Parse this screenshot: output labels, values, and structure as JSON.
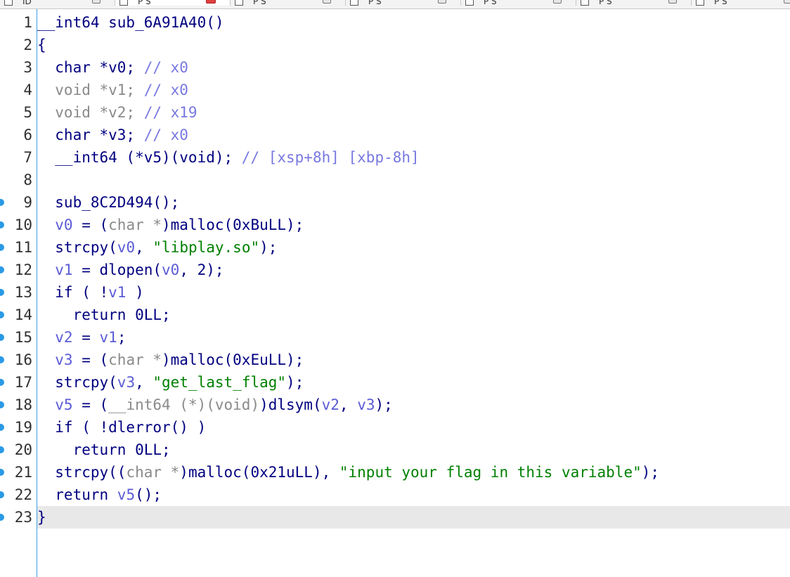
{
  "tabs": [
    {
      "label": "ID",
      "active": false
    },
    {
      "label": "P S",
      "active": true
    },
    {
      "label": "P S",
      "active": false
    },
    {
      "label": "P S",
      "active": false
    },
    {
      "label": "P S",
      "active": false
    },
    {
      "label": "P S",
      "active": false
    },
    {
      "label": "P S",
      "active": false
    }
  ],
  "colors": {
    "keyword": "#000080",
    "variable": "#5b5bd6",
    "string": "#008000",
    "comment": "#7878e0",
    "gutter_border": "#3aa0e6",
    "breakpoint": "#2a9ae6",
    "current_line": "#e8e8e8"
  },
  "editor": {
    "current_line": 23,
    "lines": [
      {
        "no": "1",
        "dot": false,
        "tokens": [
          [
            "id",
            "__int64 sub_6A91A40()"
          ]
        ]
      },
      {
        "no": "2",
        "dot": false,
        "tokens": [
          [
            "id",
            "{"
          ]
        ]
      },
      {
        "no": "3",
        "dot": false,
        "tokens": [
          [
            "id",
            "  char *v0; "
          ],
          [
            "cmt",
            "// x0"
          ]
        ]
      },
      {
        "no": "4",
        "dot": false,
        "tokens": [
          [
            "type",
            "  void *v1; "
          ],
          [
            "cmt",
            "// x0"
          ]
        ]
      },
      {
        "no": "5",
        "dot": false,
        "tokens": [
          [
            "type",
            "  void *v2; "
          ],
          [
            "cmt",
            "// x19"
          ]
        ]
      },
      {
        "no": "6",
        "dot": false,
        "tokens": [
          [
            "id",
            "  char *v3; "
          ],
          [
            "cmt",
            "// x0"
          ]
        ]
      },
      {
        "no": "7",
        "dot": false,
        "tokens": [
          [
            "id",
            "  __int64 (*v5)(void); "
          ],
          [
            "cmt",
            "// [xsp+8h] [xbp-8h]"
          ]
        ]
      },
      {
        "no": "8",
        "dot": false,
        "tokens": [
          [
            "id",
            ""
          ]
        ]
      },
      {
        "no": "9",
        "dot": true,
        "tokens": [
          [
            "id",
            "  sub_8C2D494();"
          ]
        ]
      },
      {
        "no": "10",
        "dot": true,
        "tokens": [
          [
            "var",
            "  v0"
          ],
          [
            "id",
            " = ("
          ],
          [
            "type",
            "char *"
          ],
          [
            "id",
            ")malloc(0xBuLL);"
          ]
        ]
      },
      {
        "no": "11",
        "dot": true,
        "tokens": [
          [
            "id",
            "  strcpy("
          ],
          [
            "var",
            "v0"
          ],
          [
            "id",
            ", "
          ],
          [
            "str",
            "\"libplay.so\""
          ],
          [
            "id",
            ");"
          ]
        ]
      },
      {
        "no": "12",
        "dot": true,
        "tokens": [
          [
            "var",
            "  v1"
          ],
          [
            "id",
            " = dlopen("
          ],
          [
            "var",
            "v0"
          ],
          [
            "id",
            ", 2);"
          ]
        ]
      },
      {
        "no": "13",
        "dot": true,
        "tokens": [
          [
            "id",
            "  if ( !"
          ],
          [
            "var",
            "v1"
          ],
          [
            "id",
            " )"
          ]
        ]
      },
      {
        "no": "14",
        "dot": true,
        "tokens": [
          [
            "id",
            "    return 0LL;"
          ]
        ]
      },
      {
        "no": "15",
        "dot": true,
        "tokens": [
          [
            "var",
            "  v2"
          ],
          [
            "id",
            " = "
          ],
          [
            "var",
            "v1"
          ],
          [
            "id",
            ";"
          ]
        ]
      },
      {
        "no": "16",
        "dot": true,
        "tokens": [
          [
            "var",
            "  v3"
          ],
          [
            "id",
            " = ("
          ],
          [
            "type",
            "char *"
          ],
          [
            "id",
            ")malloc(0xEuLL);"
          ]
        ]
      },
      {
        "no": "17",
        "dot": true,
        "tokens": [
          [
            "id",
            "  strcpy("
          ],
          [
            "var",
            "v3"
          ],
          [
            "id",
            ", "
          ],
          [
            "str",
            "\"get_last_flag\""
          ],
          [
            "id",
            ");"
          ]
        ]
      },
      {
        "no": "18",
        "dot": true,
        "tokens": [
          [
            "var",
            "  v5"
          ],
          [
            "id",
            " = ("
          ],
          [
            "type",
            "__int64 (*)(void)"
          ],
          [
            "id",
            ")dlsym("
          ],
          [
            "var",
            "v2"
          ],
          [
            "id",
            ", "
          ],
          [
            "var",
            "v3"
          ],
          [
            "id",
            ");"
          ]
        ]
      },
      {
        "no": "19",
        "dot": true,
        "tokens": [
          [
            "id",
            "  if ( !dlerror() )"
          ]
        ]
      },
      {
        "no": "20",
        "dot": true,
        "tokens": [
          [
            "id",
            "    return 0LL;"
          ]
        ]
      },
      {
        "no": "21",
        "dot": true,
        "tokens": [
          [
            "id",
            "  strcpy(("
          ],
          [
            "type",
            "char *"
          ],
          [
            "id",
            ")malloc(0x21uLL), "
          ],
          [
            "str",
            "\"input your flag in this variable\""
          ],
          [
            "id",
            ");"
          ]
        ]
      },
      {
        "no": "22",
        "dot": true,
        "tokens": [
          [
            "id",
            "  return "
          ],
          [
            "var",
            "v5"
          ],
          [
            "id",
            "();"
          ]
        ]
      },
      {
        "no": "23",
        "dot": true,
        "tokens": [
          [
            "id",
            "}"
          ]
        ]
      }
    ]
  }
}
